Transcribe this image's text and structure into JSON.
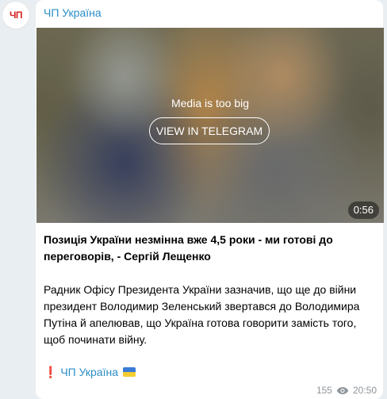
{
  "channel": {
    "avatar_text": "ЧП",
    "name": "ЧП Україна"
  },
  "media": {
    "message": "Media is too big",
    "button_label": "VIEW IN TELEGRAM",
    "duration": "0:56"
  },
  "post": {
    "title": "Позиція України незмінна вже 4,5 роки - ми готові до переговорів, - Сергій Лещенко",
    "body": "Радник Офісу Президента України зазначив, що ще до війни президент Володимир Зеленський звертався до Володимира Путіна й апелював, що Україна готова говорити замість того, щоб починати війну.",
    "footer_mark": "❗",
    "footer_link": "ЧП Україна",
    "footer_flag": "ukraine-flag"
  },
  "meta": {
    "views": "155",
    "views_icon": "eye-icon",
    "time": "20:50"
  }
}
